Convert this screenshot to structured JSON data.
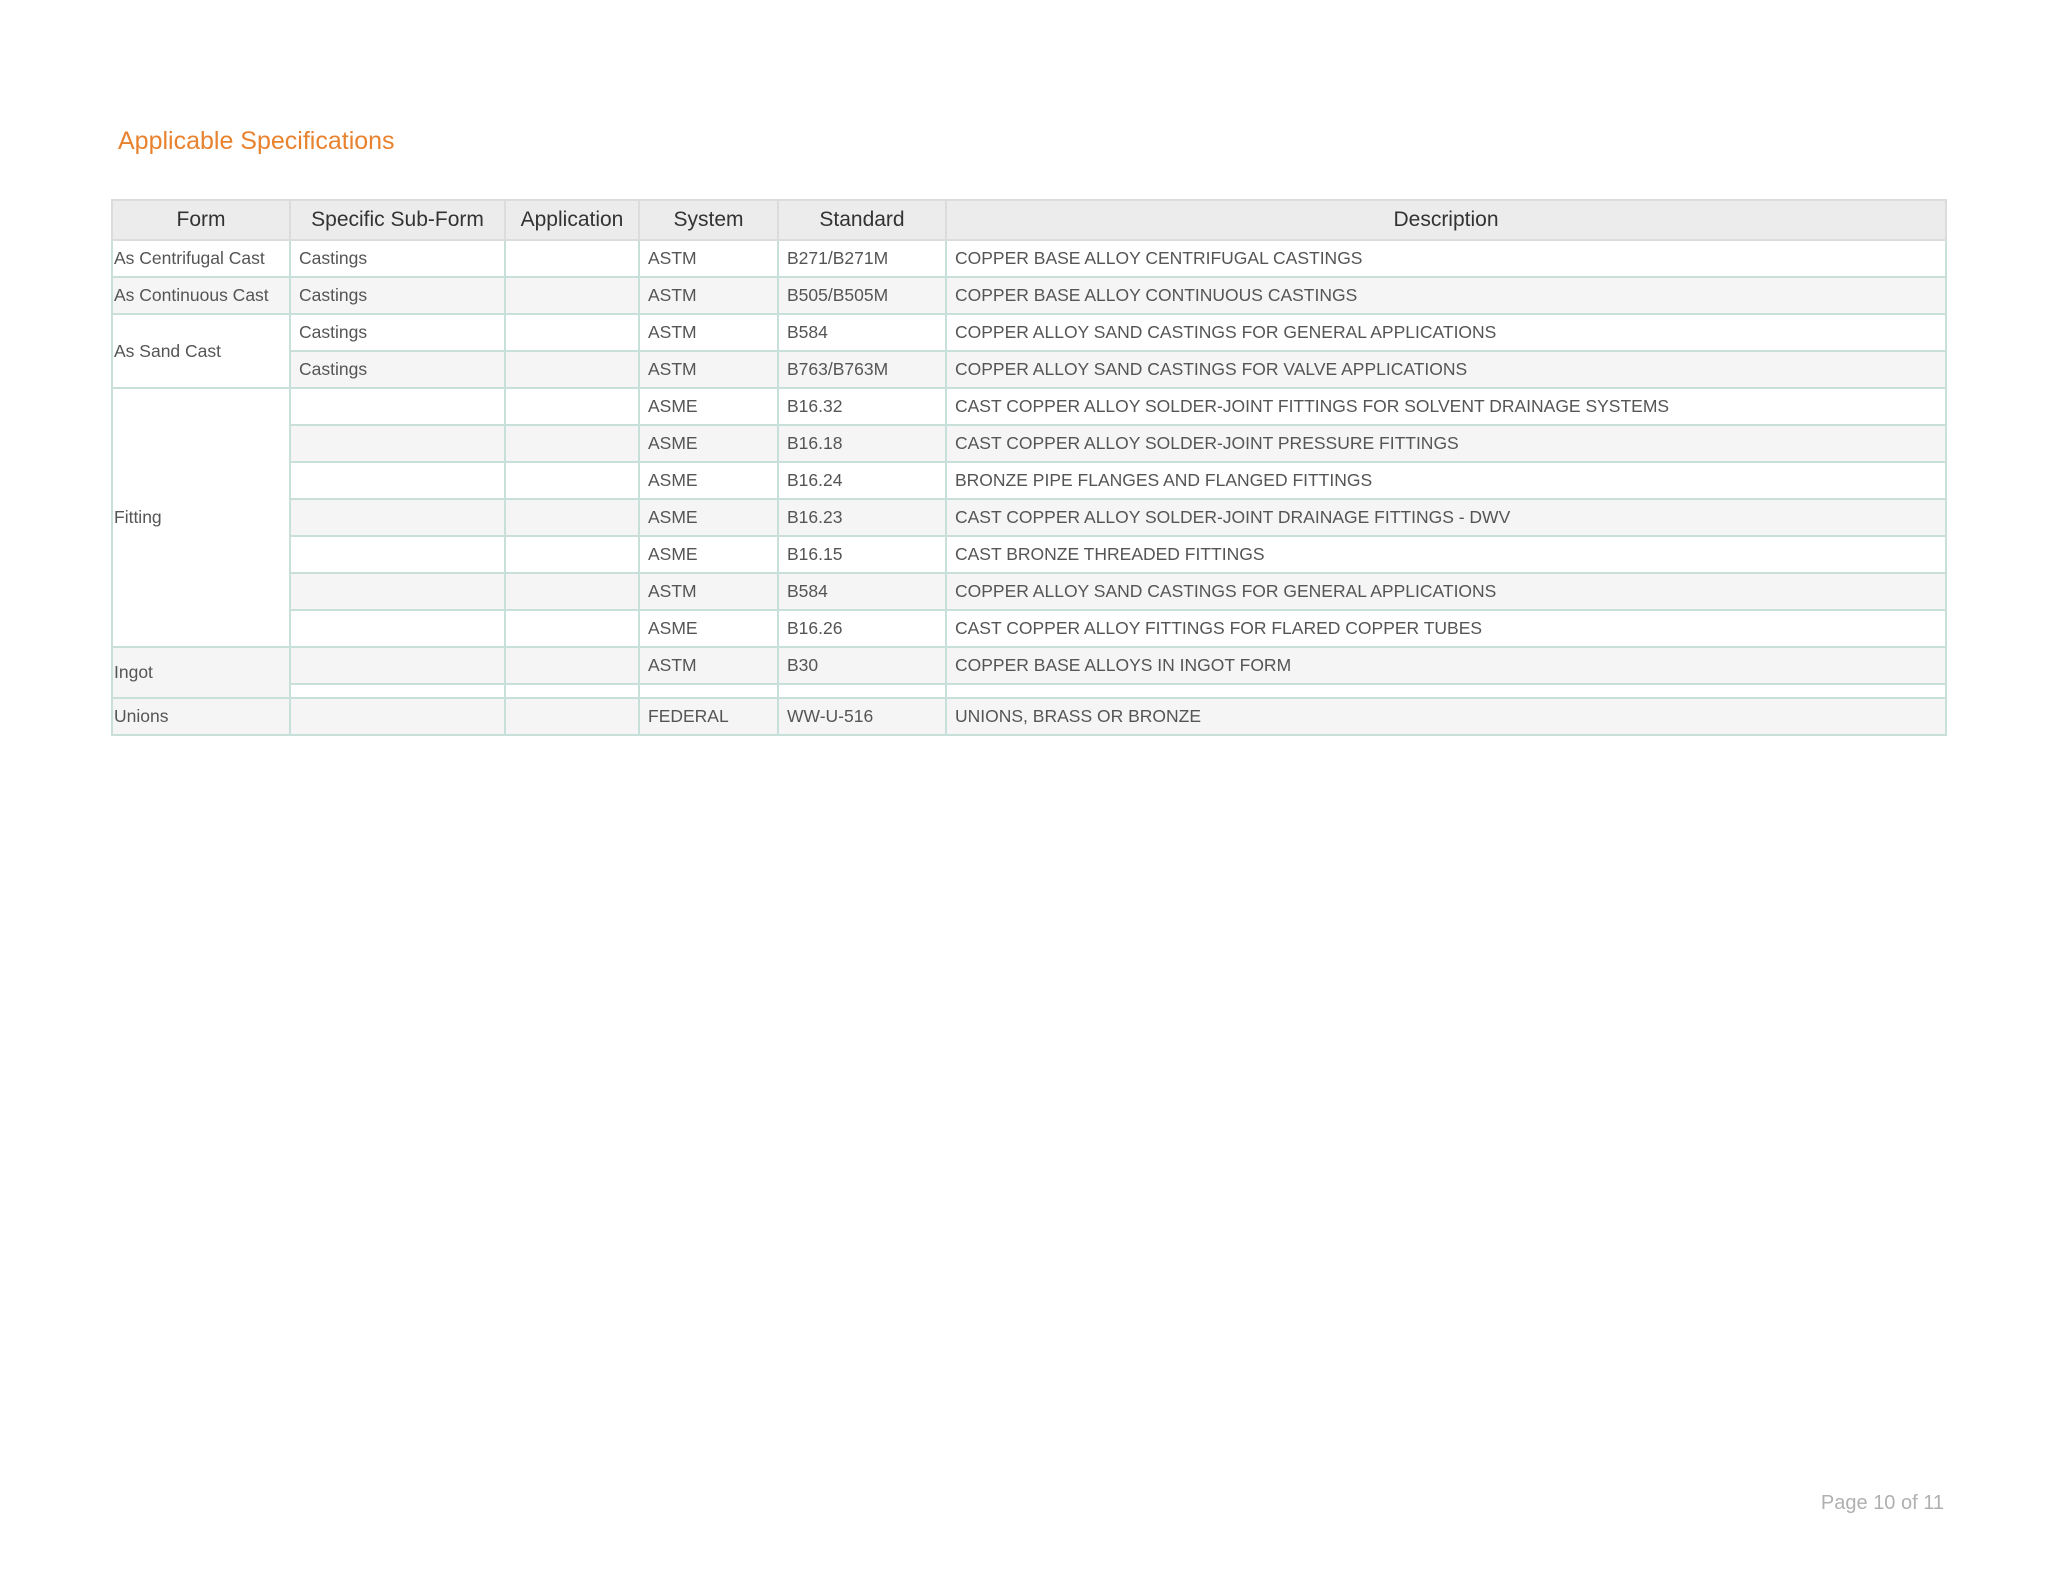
{
  "title": "Applicable Specifications",
  "table": {
    "headers": [
      "Form",
      "Specific Sub-Form",
      "Application",
      "System",
      "Standard",
      "Description"
    ],
    "groups": [
      {
        "form": "As Centrifugal Cast",
        "rows": [
          {
            "sub_form": "Castings",
            "application": "",
            "system": "ASTM",
            "standard": "B271/B271M",
            "description": "COPPER BASE ALLOY CENTRIFUGAL CASTINGS"
          }
        ]
      },
      {
        "form": "As Continuous Cast",
        "rows": [
          {
            "sub_form": "Castings",
            "application": "",
            "system": "ASTM",
            "standard": "B505/B505M",
            "description": "COPPER BASE ALLOY CONTINUOUS CASTINGS"
          }
        ]
      },
      {
        "form": "As Sand Cast",
        "rows": [
          {
            "sub_form": "Castings",
            "application": "",
            "system": "ASTM",
            "standard": "B584",
            "description": "COPPER ALLOY SAND CASTINGS FOR GENERAL APPLICATIONS"
          },
          {
            "sub_form": "Castings",
            "application": "",
            "system": "ASTM",
            "standard": "B763/B763M",
            "description": "COPPER ALLOY SAND CASTINGS FOR VALVE APPLICATIONS"
          }
        ]
      },
      {
        "form": "Fitting",
        "rows": [
          {
            "sub_form": "",
            "application": "",
            "system": "ASME",
            "standard": "B16.32",
            "description": "CAST COPPER ALLOY SOLDER-JOINT FITTINGS FOR SOLVENT DRAINAGE SYSTEMS"
          },
          {
            "sub_form": "",
            "application": "",
            "system": "ASME",
            "standard": "B16.18",
            "description": "CAST COPPER ALLOY SOLDER-JOINT PRESSURE FITTINGS"
          },
          {
            "sub_form": "",
            "application": "",
            "system": "ASME",
            "standard": "B16.24",
            "description": "BRONZE PIPE FLANGES AND FLANGED FITTINGS"
          },
          {
            "sub_form": "",
            "application": "",
            "system": "ASME",
            "standard": "B16.23",
            "description": "CAST COPPER ALLOY SOLDER-JOINT DRAINAGE FITTINGS - DWV"
          },
          {
            "sub_form": "",
            "application": "",
            "system": "ASME",
            "standard": "B16.15",
            "description": "CAST BRONZE THREADED FITTINGS"
          },
          {
            "sub_form": "",
            "application": "",
            "system": "ASTM",
            "standard": "B584",
            "description": "COPPER ALLOY SAND CASTINGS FOR GENERAL APPLICATIONS"
          },
          {
            "sub_form": "",
            "application": "",
            "system": "ASME",
            "standard": "B16.26",
            "description": "CAST COPPER ALLOY FITTINGS FOR FLARED COPPER TUBES"
          }
        ]
      },
      {
        "form": "Ingot",
        "rows": [
          {
            "sub_form": "",
            "application": "",
            "system": "ASTM",
            "standard": "B30",
            "description": "COPPER BASE ALLOYS IN INGOT FORM"
          },
          {
            "sub_form": "",
            "application": "",
            "system": "",
            "standard": "",
            "description": "",
            "thin": true
          }
        ]
      },
      {
        "form": "Unions",
        "rows": [
          {
            "sub_form": "",
            "application": "",
            "system": "FEDERAL",
            "standard": "WW-U-516",
            "description": "UNIONS, BRASS OR BRONZE"
          }
        ]
      }
    ]
  },
  "page_number": "Page 10 of 11"
}
